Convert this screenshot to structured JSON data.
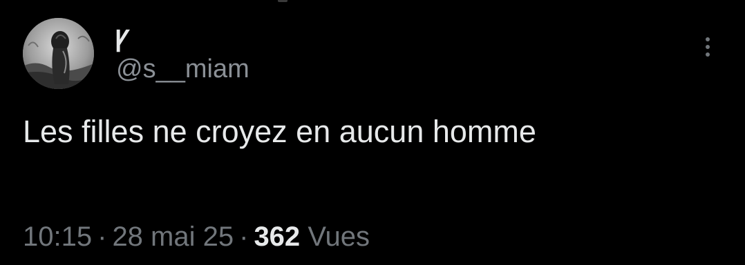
{
  "tweet": {
    "display_name": "ꝩ",
    "handle": "@s__miam",
    "text": "Les filles ne croyez en aucun homme",
    "time": "10:15",
    "date": "28 mai 25",
    "separator": "·",
    "views_count": "362",
    "views_label": "Vues"
  },
  "icons": {
    "more": "more-vertical-icon"
  },
  "colors": {
    "background": "#000000",
    "primary_text": "#e7e9ea",
    "secondary_text": "#71767b"
  }
}
